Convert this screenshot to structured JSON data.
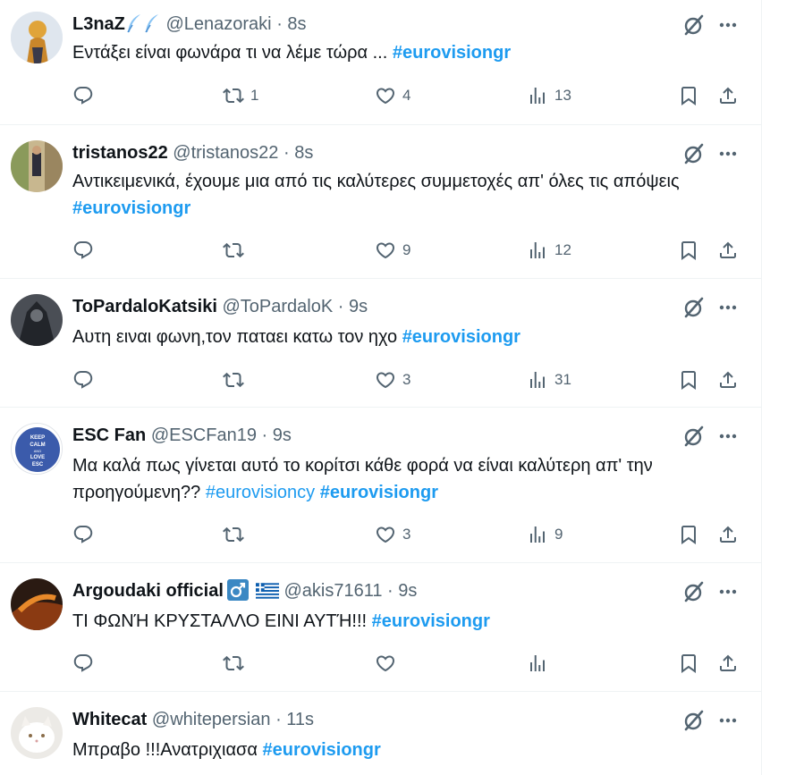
{
  "colors": {
    "accent": "#1d9bf0",
    "muted": "#536471",
    "text": "#0f1419"
  },
  "tweets": [
    {
      "name": "L3naZ",
      "name_emoji": "feather-emoji",
      "handle": "@Lenazoraki",
      "dot": "·",
      "time": "8s",
      "text": "Εντάξει είναι φωνάρα τι να λέμε τώρα ...",
      "hashtags": [
        "#eurovisiongr"
      ],
      "replies": "",
      "reposts": "1",
      "likes": "4",
      "views": "13"
    },
    {
      "name": "tristanos22",
      "handle": "@tristanos22",
      "dot": "·",
      "time": "8s",
      "text": "Αντικειμενικά, έχουμε μια από τις καλύτερες συμμετοχές απ' όλες τις απόψεις",
      "hashtags": [
        "#eurovisiongr"
      ],
      "replies": "",
      "reposts": "",
      "likes": "9",
      "views": "12"
    },
    {
      "name": "ToPardaloKatsiki",
      "handle": "@ToPardaloK",
      "dot": "·",
      "time": "9s",
      "text": "Αυτη ειναι φωνη,τον παταει κατω τον ηχο",
      "hashtags": [
        "#eurovisiongr"
      ],
      "replies": "",
      "reposts": "",
      "likes": "3",
      "views": "31"
    },
    {
      "name": "ESC Fan",
      "handle": "@ESCFan19",
      "dot": "·",
      "time": "9s",
      "text": "Μα καλά πως γίνεται αυτό το κορίτσι κάθε φορά να είναι καλύτερη απ' την",
      "text2": "προηγούμενη??",
      "hashtags": [
        "#eurovisioncy",
        "#eurovisiongr"
      ],
      "replies": "",
      "reposts": "",
      "likes": "3",
      "views": "9"
    },
    {
      "name": "Argoudaki official",
      "handle": "@akis71611",
      "dot": "·",
      "time": "9s",
      "text": "ΤΙ ΦΩΝΉ ΚΡΥΣΤΑΛΛΟ ΕΙΝΙ ΑΥΤΉ!!!",
      "hashtags": [
        "#eurovisiongr"
      ],
      "replies": "",
      "reposts": "",
      "likes": "",
      "views": ""
    },
    {
      "name": "Whitecat",
      "handle": "@whitepersian",
      "dot": "·",
      "time": "11s",
      "text": "Μπραβο !!!Ανατριχιασα",
      "hashtags": [
        "#eurovisiongr"
      ]
    }
  ],
  "avatar_badges": {
    "esc_fan": [
      "KEEP",
      "CALM",
      "AND",
      "LOVE",
      "ESC"
    ]
  }
}
